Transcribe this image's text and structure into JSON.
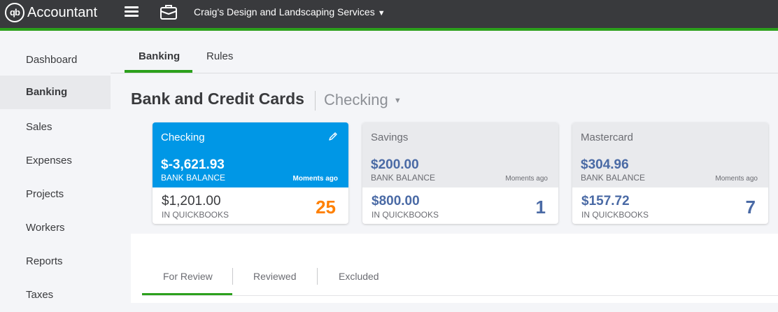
{
  "app": {
    "logo": "qb",
    "title": "Accountant",
    "company": "Craig's Design and Landscaping Services",
    "accent": "#2ca01c",
    "topbar_bg": "#393a3d"
  },
  "sidebar": {
    "items": [
      {
        "label": "Dashboard"
      },
      {
        "label": "Banking"
      },
      {
        "label": "Sales"
      },
      {
        "label": "Expenses"
      },
      {
        "label": "Projects"
      },
      {
        "label": "Workers"
      },
      {
        "label": "Reports"
      },
      {
        "label": "Taxes"
      }
    ],
    "active": "Banking"
  },
  "tabs": [
    {
      "label": "Banking"
    },
    {
      "label": "Rules"
    }
  ],
  "page": {
    "title": "Bank and Credit Cards",
    "account_selector": "Checking"
  },
  "cards": [
    {
      "name": "Checking",
      "bank_balance": "$-3,621.93",
      "bank_label": "BANK BALANCE",
      "updated": "Moments ago",
      "qb_balance": "$1,201.00",
      "qb_label": "IN QUICKBOOKS",
      "count": "25",
      "selected_color": "#0097e6",
      "count_color": "#ff8000"
    },
    {
      "name": "Savings",
      "bank_balance": "$200.00",
      "bank_label": "BANK BALANCE",
      "updated": "Moments ago",
      "qb_balance": "$800.00",
      "qb_label": "IN QUICKBOOKS",
      "count": "1"
    },
    {
      "name": "Mastercard",
      "bank_balance": "$304.96",
      "bank_label": "BANK BALANCE",
      "updated": "Moments ago",
      "qb_balance": "$157.72",
      "qb_label": "IN QUICKBOOKS",
      "count": "7"
    }
  ],
  "subtabs": [
    {
      "label": "For Review"
    },
    {
      "label": "Reviewed"
    },
    {
      "label": "Excluded"
    }
  ],
  "icons": [
    "hamburger-menu-icon",
    "briefcase-icon",
    "caret-down-icon",
    "pencil-edit-icon"
  ]
}
